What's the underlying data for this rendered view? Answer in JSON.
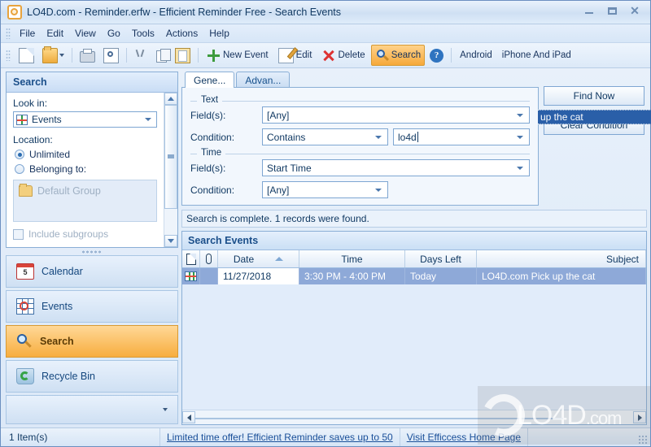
{
  "window": {
    "title": "LO4D.com - Reminder.erfw - Efficient Reminder Free - Search Events",
    "icon": "reminder-app-icon",
    "controls": {
      "minimize": "minimize",
      "maximize": "maximize",
      "close": "close"
    }
  },
  "menu": {
    "items": [
      "File",
      "Edit",
      "View",
      "Go",
      "Tools",
      "Actions",
      "Help"
    ]
  },
  "toolbar": {
    "buttons": [
      {
        "label": "",
        "icon": "new-document-icon",
        "active": false
      },
      {
        "label": "",
        "icon": "open-folder-icon",
        "active": false,
        "dropdown": true
      },
      {
        "label": "",
        "icon": "print-icon",
        "active": false
      },
      {
        "label": "",
        "icon": "print-preview-icon",
        "active": false
      },
      {
        "label": "",
        "icon": "cut-icon",
        "active": false
      },
      {
        "label": "",
        "icon": "copy-icon",
        "active": false
      },
      {
        "label": "",
        "icon": "paste-icon",
        "active": false
      },
      {
        "label": "New Event",
        "icon": "plus-icon",
        "active": false
      },
      {
        "label": "Edit",
        "icon": "edit-pencil-icon",
        "active": false
      },
      {
        "label": "Delete",
        "icon": "delete-x-icon",
        "active": false
      },
      {
        "label": "Search",
        "icon": "magnifier-icon",
        "active": true
      },
      {
        "label": "",
        "icon": "help-icon",
        "active": false
      },
      {
        "label": "Android",
        "icon": "",
        "active": false
      },
      {
        "label": "iPhone And iPad",
        "icon": "",
        "active": false
      }
    ],
    "help_glyph": "?"
  },
  "search_panel": {
    "header": "Search",
    "look_in_label": "Look in:",
    "look_in_value": "Events",
    "location_label": "Location:",
    "radio_unlimited": "Unlimited",
    "radio_belonging": "Belonging to:",
    "group_value": "Default Group",
    "include_subgroups": "Include subgroups"
  },
  "nav": {
    "items": [
      {
        "label": "Calendar",
        "icon": "calendar-icon",
        "selected": false
      },
      {
        "label": "Events",
        "icon": "events-grid-icon",
        "selected": false
      },
      {
        "label": "Search",
        "icon": "magnifier-icon",
        "selected": true
      },
      {
        "label": "Recycle Bin",
        "icon": "recycle-bin-icon",
        "selected": false
      }
    ]
  },
  "criteria": {
    "tabs": [
      {
        "label": "Gene...",
        "active": true
      },
      {
        "label": "Advan...",
        "active": false
      }
    ],
    "text_group": {
      "legend": "Text",
      "field_label": "Field(s):",
      "field_value": "[Any]",
      "condition_label": "Condition:",
      "condition_value": "Contains",
      "keyword_value": "lo4d"
    },
    "time_group": {
      "legend": "Time",
      "field_label": "Field(s):",
      "field_value": "Start Time",
      "condition_label": "Condition:",
      "condition_value": "[Any]"
    },
    "buttons": {
      "find_now": "Find Now",
      "clear_condition": "Clear Condition"
    },
    "floating_selection": "up the cat"
  },
  "status_message": "Search is complete. 1 records were found.",
  "results": {
    "header": "Search Events",
    "columns": [
      {
        "label": "",
        "icon": "document-icon"
      },
      {
        "label": "",
        "icon": "paperclip-icon"
      },
      {
        "label": "Date",
        "sorted": "asc"
      },
      {
        "label": "Time"
      },
      {
        "label": "Days Left"
      },
      {
        "label": "Subject",
        "align": "right"
      }
    ],
    "rows": [
      {
        "icon": "event-grid-icon",
        "date": "11/27/2018",
        "time": "3:30 PM - 4:00 PM",
        "days_left": "Today",
        "subject": "LO4D.com Pick up the cat"
      }
    ]
  },
  "statusbar": {
    "items_count": "1 Item(s)",
    "offer_link": "Limited time offer! Efficient Reminder saves up to 50",
    "home_link": "Visit Efficcess Home Page"
  },
  "watermark": {
    "text": "LO4D",
    "suffix": ".com"
  },
  "colors": {
    "accent_orange": "#f7ad3e",
    "selection_blue": "#2a5fa8",
    "row_blue": "#8ea9d8",
    "title_text": "#123a63"
  }
}
